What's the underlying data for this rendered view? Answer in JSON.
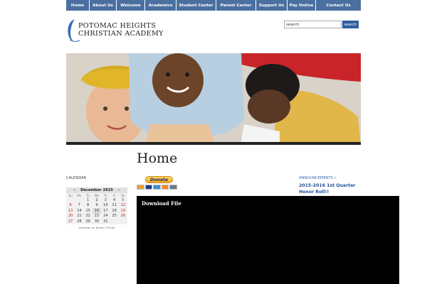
{
  "nav": {
    "items": [
      {
        "label": "Home"
      },
      {
        "label": "About Us"
      },
      {
        "label": "Welcome"
      },
      {
        "label": "Academics"
      },
      {
        "label": "Student Center"
      },
      {
        "label": "Parent Center"
      },
      {
        "label": "Support Us"
      },
      {
        "label": "Pay Online"
      },
      {
        "label": "Contact Us"
      }
    ]
  },
  "logo": {
    "line1": "Potomac Heights",
    "line2": "Christian Academy"
  },
  "search": {
    "value": "search",
    "button_label": "search"
  },
  "page": {
    "title": "Home"
  },
  "calendar": {
    "label": "CALENDAR",
    "prev": "«",
    "next": "»",
    "month": "December 2015",
    "weekdays": [
      "Su",
      "Mo",
      "Tu",
      "We",
      "Th",
      "Fr",
      "Sa"
    ],
    "weeks": [
      [
        "",
        "",
        "1",
        "2",
        "3",
        "4",
        "5"
      ],
      [
        "6",
        "7",
        "8",
        "9",
        "10",
        "11",
        "12"
      ],
      [
        "13",
        "14",
        "15",
        "16",
        "17",
        "18",
        "19"
      ],
      [
        "20",
        "21",
        "22",
        "23",
        "24",
        "25",
        "26"
      ],
      [
        "27",
        "28",
        "29",
        "30",
        "31",
        "",
        ""
      ]
    ],
    "today": "16",
    "credit": "Calendar by Kieran O'Shea"
  },
  "donate": {
    "label": "Donate",
    "cards": [
      {
        "icon": "mastercard-icon",
        "color": "#e9a12a"
      },
      {
        "icon": "visa-icon",
        "color": "#1a3d8f"
      },
      {
        "icon": "amex-icon",
        "color": "#3a8fd0"
      },
      {
        "icon": "discover-icon",
        "color": "#f08a24"
      },
      {
        "icon": "echeck-icon",
        "color": "#6a7a8a"
      }
    ]
  },
  "announcements": {
    "link": "ANNOUNCEMENTS »",
    "title": "2015-2016 1st Quarter Honor Roll!!"
  },
  "download": {
    "label": "Download File"
  }
}
